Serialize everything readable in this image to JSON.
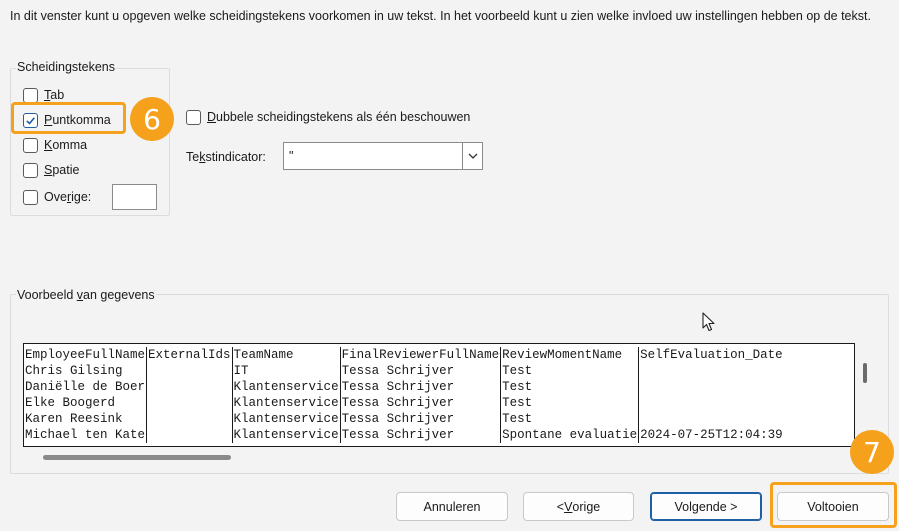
{
  "intro_text": "In dit venster kunt u opgeven welke scheidingstekens voorkomen in uw tekst. In het voorbeeld kunt u zien welke invloed uw instellingen hebben op de tekst.",
  "delimiters": {
    "title": "Scheidingstekens",
    "tab": {
      "pre": "",
      "u": "T",
      "post": "ab",
      "checked": false
    },
    "semicolon": {
      "pre": "",
      "u": "P",
      "post": "untkomma",
      "checked": true
    },
    "comma": {
      "pre": "",
      "u": "K",
      "post": "omma",
      "checked": false
    },
    "space": {
      "pre": "",
      "u": "S",
      "post": "patie",
      "checked": false
    },
    "other": {
      "pre": "Ove",
      "u": "r",
      "post": "ige:",
      "checked": false,
      "value": ""
    }
  },
  "consecutive": {
    "pre": "",
    "u": "D",
    "post": "ubbele scheidingstekens als één beschouwen",
    "checked": false
  },
  "qualifier": {
    "pre": "Te",
    "u": "k",
    "post": "stindicator:",
    "value": "\""
  },
  "preview": {
    "title_pre": "Voorbeeld ",
    "title_u": "v",
    "title_post": "an gegevens",
    "rows": [
      [
        "EmployeeFullName",
        "ExternalIds",
        "TeamName",
        "FinalReviewerFullName",
        "ReviewMomentName",
        "SelfEvaluation_Date"
      ],
      [
        "Chris Gilsing",
        "",
        "IT",
        "Tessa Schrijver",
        "Test",
        ""
      ],
      [
        "Daniëlle de Boer",
        "",
        "Klantenservice",
        "Tessa Schrijver",
        "Test",
        ""
      ],
      [
        "Elke Boogerd",
        "",
        "Klantenservice",
        "Tessa Schrijver",
        "Test",
        ""
      ],
      [
        "Karen Reesink",
        "",
        "Klantenservice",
        "Tessa Schrijver",
        "Test",
        ""
      ],
      [
        "Michael ten Kate",
        "",
        "Klantenservice",
        "Tessa Schrijver",
        "Spontane evaluatie",
        "2024-07-25T12:04:39"
      ]
    ]
  },
  "buttons": {
    "cancel": "Annuleren",
    "back": {
      "pre": "< ",
      "u": "V",
      "post": "orige"
    },
    "next": {
      "pre": "Vol",
      "u": "g",
      "post": "ende >"
    },
    "finish": "Voltooien"
  },
  "annotations": {
    "step6": "6",
    "step7": "7",
    "color": "#f5a11c"
  },
  "icons": {
    "check": "check-icon",
    "dropdown": "chevron-down-icon",
    "cursor": "mouse-pointer-icon"
  }
}
